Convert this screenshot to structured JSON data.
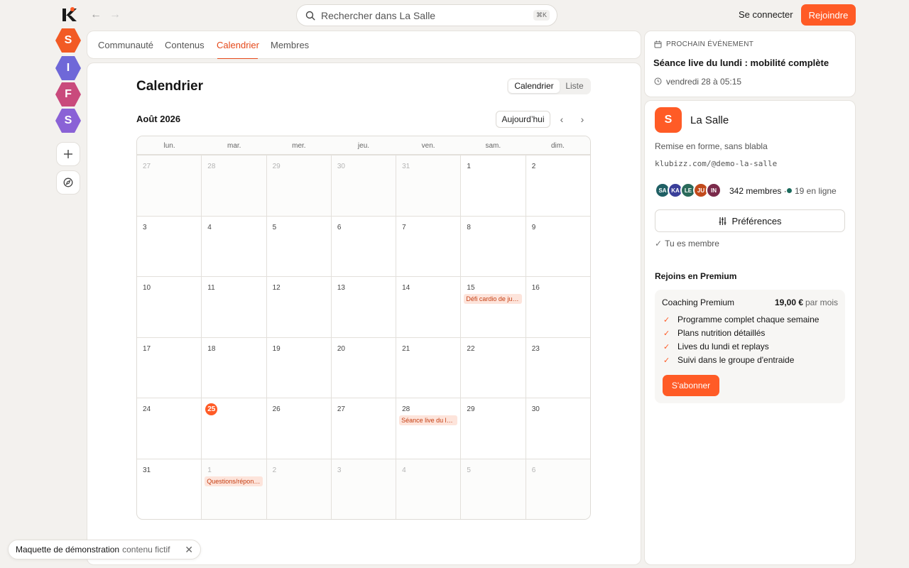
{
  "topbar": {
    "search_placeholder": "Rechercher dans La Salle",
    "search_shortcut": "⌘K",
    "login_label": "Se connecter",
    "join_label": "Rejoindre"
  },
  "rail": {
    "communities": [
      {
        "letter": "S",
        "color": "#f25a24"
      },
      {
        "letter": "I",
        "color": "#6f68d8"
      },
      {
        "letter": "F",
        "color": "#c94a7c"
      },
      {
        "letter": "S",
        "color": "#8a62d6"
      }
    ]
  },
  "tabs": [
    {
      "label": "Communauté",
      "active": false
    },
    {
      "label": "Contenus",
      "active": false
    },
    {
      "label": "Calendrier",
      "active": true
    },
    {
      "label": "Membres",
      "active": false
    }
  ],
  "calendar": {
    "title": "Calendrier",
    "view_toggle": {
      "calendar": "Calendrier",
      "list": "Liste"
    },
    "month_label": "Août 2026",
    "today_label": "Aujourd’hui",
    "weekdays": [
      "lun.",
      "mar.",
      "mer.",
      "jeu.",
      "ven.",
      "sam.",
      "dim."
    ],
    "weeks": [
      [
        {
          "n": "27",
          "out": true
        },
        {
          "n": "28",
          "out": true
        },
        {
          "n": "29",
          "out": true
        },
        {
          "n": "30",
          "out": true
        },
        {
          "n": "31",
          "out": true
        },
        {
          "n": "1"
        },
        {
          "n": "2"
        }
      ],
      [
        {
          "n": "3"
        },
        {
          "n": "4"
        },
        {
          "n": "5"
        },
        {
          "n": "6"
        },
        {
          "n": "7"
        },
        {
          "n": "8"
        },
        {
          "n": "9"
        }
      ],
      [
        {
          "n": "10"
        },
        {
          "n": "11"
        },
        {
          "n": "12"
        },
        {
          "n": "13"
        },
        {
          "n": "14"
        },
        {
          "n": "15",
          "event": "Défi cardio de juillet"
        },
        {
          "n": "16"
        }
      ],
      [
        {
          "n": "17"
        },
        {
          "n": "18"
        },
        {
          "n": "19"
        },
        {
          "n": "20"
        },
        {
          "n": "21"
        },
        {
          "n": "22"
        },
        {
          "n": "23"
        }
      ],
      [
        {
          "n": "24"
        },
        {
          "n": "25",
          "today": true
        },
        {
          "n": "26"
        },
        {
          "n": "27"
        },
        {
          "n": "28",
          "event": "Séance live du lundi"
        },
        {
          "n": "29"
        },
        {
          "n": "30"
        }
      ],
      [
        {
          "n": "31"
        },
        {
          "n": "1",
          "out": true,
          "event": "Questions/réponses"
        },
        {
          "n": "2",
          "out": true
        },
        {
          "n": "3",
          "out": true
        },
        {
          "n": "4",
          "out": true
        },
        {
          "n": "5",
          "out": true
        },
        {
          "n": "6",
          "out": true
        }
      ]
    ]
  },
  "next_event": {
    "label": "PROCHAIN ÉVÉNEMENT",
    "title": "Séance live du lundi : mobilité complète",
    "date": "vendredi 28 à 05:15"
  },
  "club": {
    "logo_letter": "S",
    "name": "La Salle",
    "tagline": "Remise en forme, sans blabla",
    "url": "klubizz.com/@demo-la-salle",
    "avatars": [
      {
        "initials": "SA",
        "color": "#1f5f64"
      },
      {
        "initials": "KA",
        "color": "#3a3f9a"
      },
      {
        "initials": "LE",
        "color": "#2a6a5a"
      },
      {
        "initials": "JU",
        "color": "#c24a1c"
      },
      {
        "initials": "IN",
        "color": "#7a2a4a"
      }
    ],
    "members": "342 membres ·",
    "online": "19 en ligne",
    "preferences_label": "Préférences",
    "member_status": "Tu es membre"
  },
  "premium": {
    "heading": "Rejoins en Premium",
    "plan_name": "Coaching Premium",
    "price": "19,00 €",
    "period": "par mois",
    "features": [
      "Programme complet chaque semaine",
      "Plans nutrition détaillés",
      "Lives du lundi et replays",
      "Suivi dans le groupe d'entraide"
    ],
    "subscribe_label": "S'abonner"
  },
  "demo_banner": {
    "title": "Maquette de démonstration",
    "subtitle": "contenu fictif"
  }
}
